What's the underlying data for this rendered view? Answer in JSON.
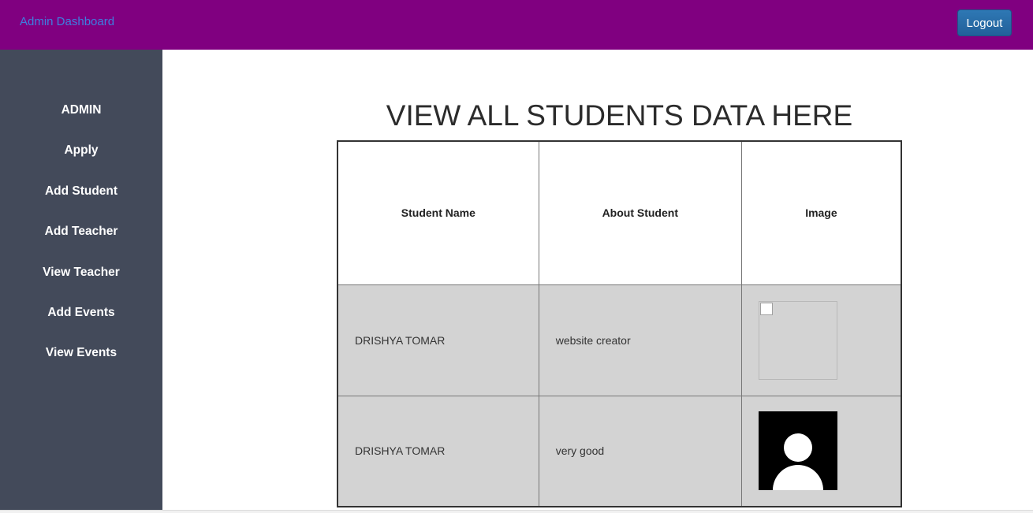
{
  "header": {
    "brand": "Admin Dashboard",
    "logout_label": "Logout"
  },
  "sidebar": {
    "items": [
      {
        "label": "ADMIN"
      },
      {
        "label": "Apply"
      },
      {
        "label": "Add Student"
      },
      {
        "label": "Add Teacher"
      },
      {
        "label": "View Teacher"
      },
      {
        "label": "Add Events"
      },
      {
        "label": "View Events"
      }
    ]
  },
  "main": {
    "title": "VIEW ALL STUDENTS DATA HERE",
    "table": {
      "headers": [
        "Student Name",
        "About Student",
        "Image"
      ],
      "rows": [
        {
          "name": "DRISHYA TOMAR",
          "about": "website creator",
          "image": "broken-image-icon"
        },
        {
          "name": "DRISHYA TOMAR",
          "about": "very good",
          "image": "user-avatar-icon"
        }
      ]
    }
  },
  "colors": {
    "topbar": "#800080",
    "sidebar": "#434a5a",
    "brand_link": "#3d7fe0",
    "logout_button": "#2e78b4",
    "row_background": "#d3d3d3"
  }
}
